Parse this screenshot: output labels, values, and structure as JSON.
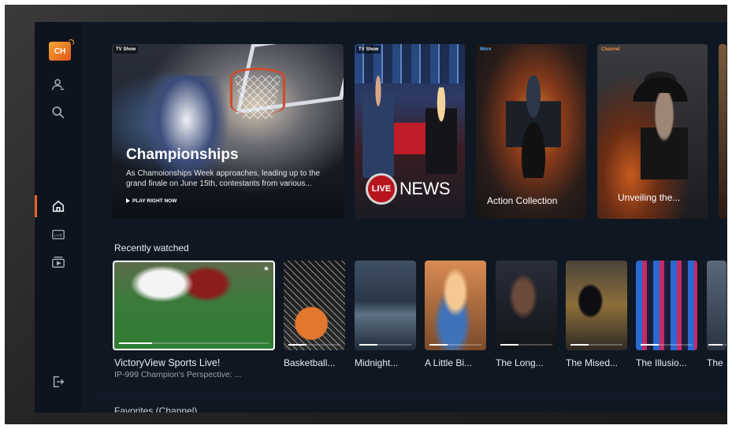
{
  "sidebar": {
    "logo_text": "CH",
    "items": [
      {
        "name": "profile",
        "icon": "user-icon"
      },
      {
        "name": "search",
        "icon": "search-icon"
      },
      {
        "name": "home",
        "icon": "home-icon",
        "active": true
      },
      {
        "name": "live",
        "icon": "live-tv-icon",
        "label": "LIVE"
      },
      {
        "name": "library",
        "icon": "library-icon"
      },
      {
        "name": "exit",
        "icon": "exit-icon"
      }
    ]
  },
  "hero": {
    "main": {
      "tag": "TV Show",
      "title": "Championships",
      "description": "As Chamoionships Week approaches, leading up to the grand finale on June 15th, contestants from various...",
      "cta": "PLAY RIGHT NOW"
    },
    "news": {
      "tag": "TV Show",
      "badge": "LIVE",
      "text": "NEWS"
    },
    "action": {
      "tag": "More",
      "caption": "Action Collection"
    },
    "channel": {
      "tag": "Channel",
      "caption": "Unveiling the..."
    }
  },
  "recently_watched": {
    "title": "Recently watched",
    "items": [
      {
        "label": "VictoryView Sports Live!",
        "subtitle": "IP-999 Champion's Perspective: ...",
        "progress": 0.22
      },
      {
        "label": "Basketball...",
        "progress": 0.35
      },
      {
        "label": "Midnight...",
        "progress": 0.35
      },
      {
        "label": "A Little Bi...",
        "progress": 0.35
      },
      {
        "label": "The Long...",
        "progress": 0.35
      },
      {
        "label": "The Mised...",
        "progress": 0.35
      },
      {
        "label": "The Illusio...",
        "progress": 0.35
      },
      {
        "label": "The",
        "progress": 0.8
      }
    ]
  },
  "favorites": {
    "title": "Favorites (Channel)"
  },
  "colors": {
    "accent": "#e7652a",
    "background": "#0f1722"
  }
}
